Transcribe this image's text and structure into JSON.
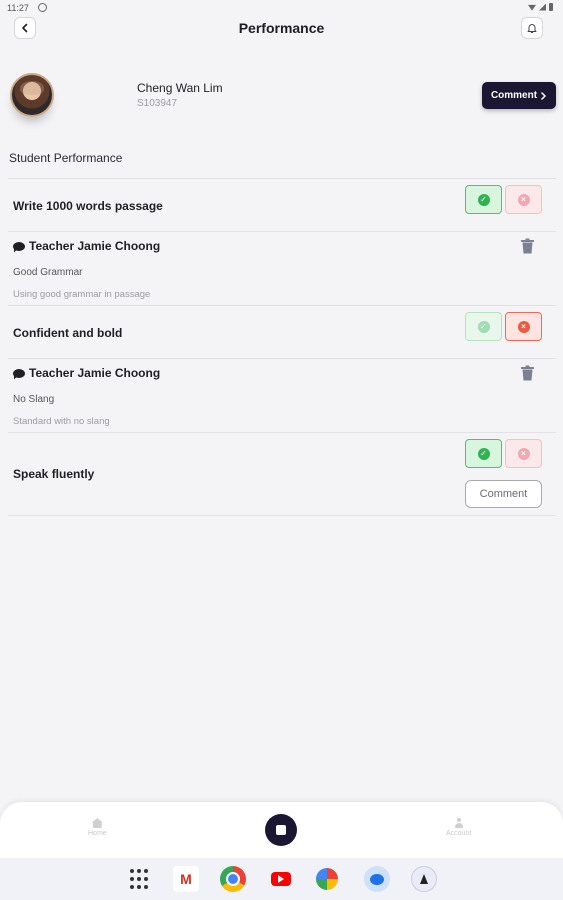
{
  "status_bar": {
    "time": "11:27"
  },
  "header": {
    "title": "Performance"
  },
  "profile": {
    "name": "Cheng Wan Lim",
    "student_id": "S103947",
    "comment_button": "Comment"
  },
  "section_title": "Student Performance",
  "tasks": [
    {
      "label": "Write 1000 words passage",
      "status": "approved"
    },
    {
      "label": "Confident and bold",
      "status": "rejected"
    },
    {
      "label": "Speak fluently",
      "status": "approved",
      "comment_button": "Comment"
    }
  ],
  "feedback": [
    {
      "teacher": "Teacher Jamie Choong",
      "title": "Good Grammar",
      "description": "Using good grammar in passage"
    },
    {
      "teacher": "Teacher Jamie Choong",
      "title": "No Slang",
      "description": "Standard with no slang"
    }
  ],
  "bottom_nav": {
    "home_label": "Home",
    "account_label": "Account"
  },
  "dock": {
    "gmail_letter": "M"
  },
  "colors": {
    "primary": "#1b1733",
    "approve": "#2fb352",
    "reject": "#ec5a41"
  },
  "icons": [
    "back-icon",
    "bell-icon",
    "chevron-right-icon",
    "check-circle-icon",
    "x-circle-icon",
    "chat-icon",
    "trash-icon",
    "home-icon",
    "account-icon"
  ]
}
